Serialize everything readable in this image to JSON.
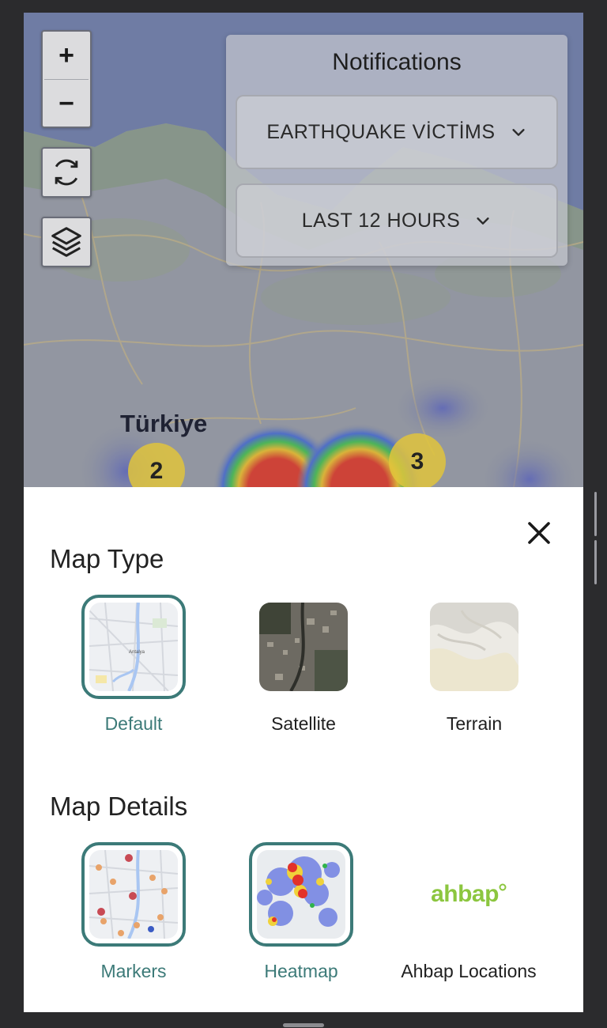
{
  "map": {
    "zoom_in_label": "+",
    "zoom_out_label": "−",
    "refresh_icon": "refresh-icon",
    "layers_icon": "layers-icon",
    "country_label": "Türkiye",
    "clusters": [
      {
        "count": "2"
      },
      {
        "count": "3"
      }
    ]
  },
  "notifications": {
    "title": "Notifications",
    "category": "EARTHQUAKE VİCTİMS",
    "time_range": "LAST 12 HOURS"
  },
  "sheet": {
    "close_icon": "close-icon",
    "map_type_title": "Map Type",
    "map_types": [
      {
        "label": "Default",
        "selected": true
      },
      {
        "label": "Satellite",
        "selected": false
      },
      {
        "label": "Terrain",
        "selected": false
      }
    ],
    "map_details_title": "Map Details",
    "map_details": [
      {
        "label": "Markers",
        "selected": true
      },
      {
        "label": "Heatmap",
        "selected": true
      },
      {
        "label": "Ahbap Locations",
        "selected": false,
        "logo_text": "ahbap"
      }
    ]
  },
  "colors": {
    "accent": "#3c7a78",
    "ahbap_green": "#8cc63f"
  }
}
